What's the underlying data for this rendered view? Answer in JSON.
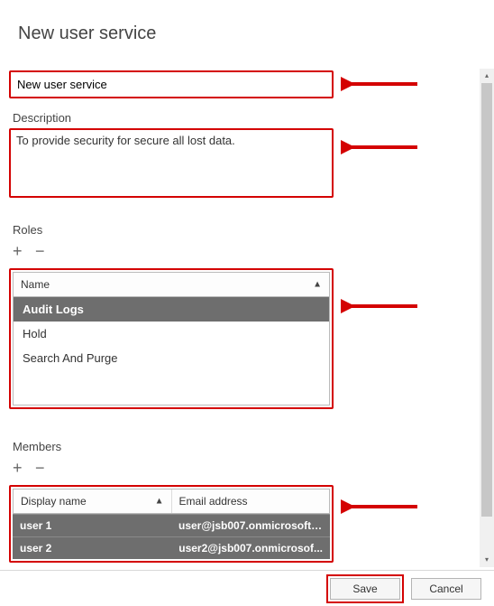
{
  "page_title": "New user service",
  "form": {
    "name_value": "New user service",
    "description_label": "Description",
    "description_value": "To provide security for secure all lost data."
  },
  "roles": {
    "section_label": "Roles",
    "header": {
      "name_col": "Name"
    },
    "items": [
      {
        "label": "Audit Logs",
        "selected": true
      },
      {
        "label": "Hold",
        "selected": false
      },
      {
        "label": "Search And Purge",
        "selected": false
      }
    ]
  },
  "members": {
    "section_label": "Members",
    "header": {
      "display_col": "Display name",
      "email_col": "Email address"
    },
    "items": [
      {
        "name": "user 1",
        "email": "user@jsb007.onmicrosoft...."
      },
      {
        "name": "user 2",
        "email": "user2@jsb007.onmicrosof..."
      }
    ]
  },
  "actions": {
    "save_label": "Save",
    "cancel_label": "Cancel"
  },
  "icons": {
    "plus": "+",
    "minus": "−",
    "sort_up": "▲"
  }
}
